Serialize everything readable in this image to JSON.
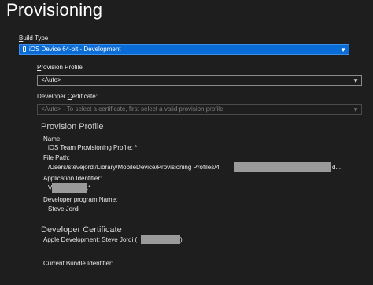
{
  "page": {
    "title": "Provisioning"
  },
  "build_type": {
    "label_prefix": "B",
    "label_rest": "uild Type",
    "selected": "iOS Device 64-bit - Development"
  },
  "provision_profile_field": {
    "label_prefix": "P",
    "label_rest": "rovision Profile",
    "selected": "<Auto>"
  },
  "developer_certificate_field": {
    "label_pre": "Developer ",
    "label_ul": "C",
    "label_post": "ertificate:",
    "selected": "<Auto> - To select a certificate, first select a valid provision profile"
  },
  "provision_profile_section": {
    "heading": "Provision Profile",
    "name_label": "Name:",
    "name_value": "iOS Team Provisioning Profile: *",
    "file_path_label": "File Path:",
    "file_path_value": "/Users/stevejordi/Library/MobileDevice/Provisioning Profiles/4",
    "file_path_suffix": "d...",
    "app_id_label": "Application Identifier:",
    "app_id_prefix": "V",
    "app_id_suffix": ".*",
    "dev_program_label": "Developer program Name:",
    "dev_program_value": "Steve Jordi"
  },
  "developer_certificate_section": {
    "heading": "Developer Certificate",
    "apple_dev_prefix": "Apple Development: Steve Jordi (",
    "apple_dev_suffix": ")",
    "bundle_label": "Current Bundle Identifier:"
  },
  "colors": {
    "accent": "#0a6cd6",
    "background": "#1e1e1e"
  },
  "icons": {
    "dropdown": "chevron-down-icon",
    "device": "device-icon"
  }
}
